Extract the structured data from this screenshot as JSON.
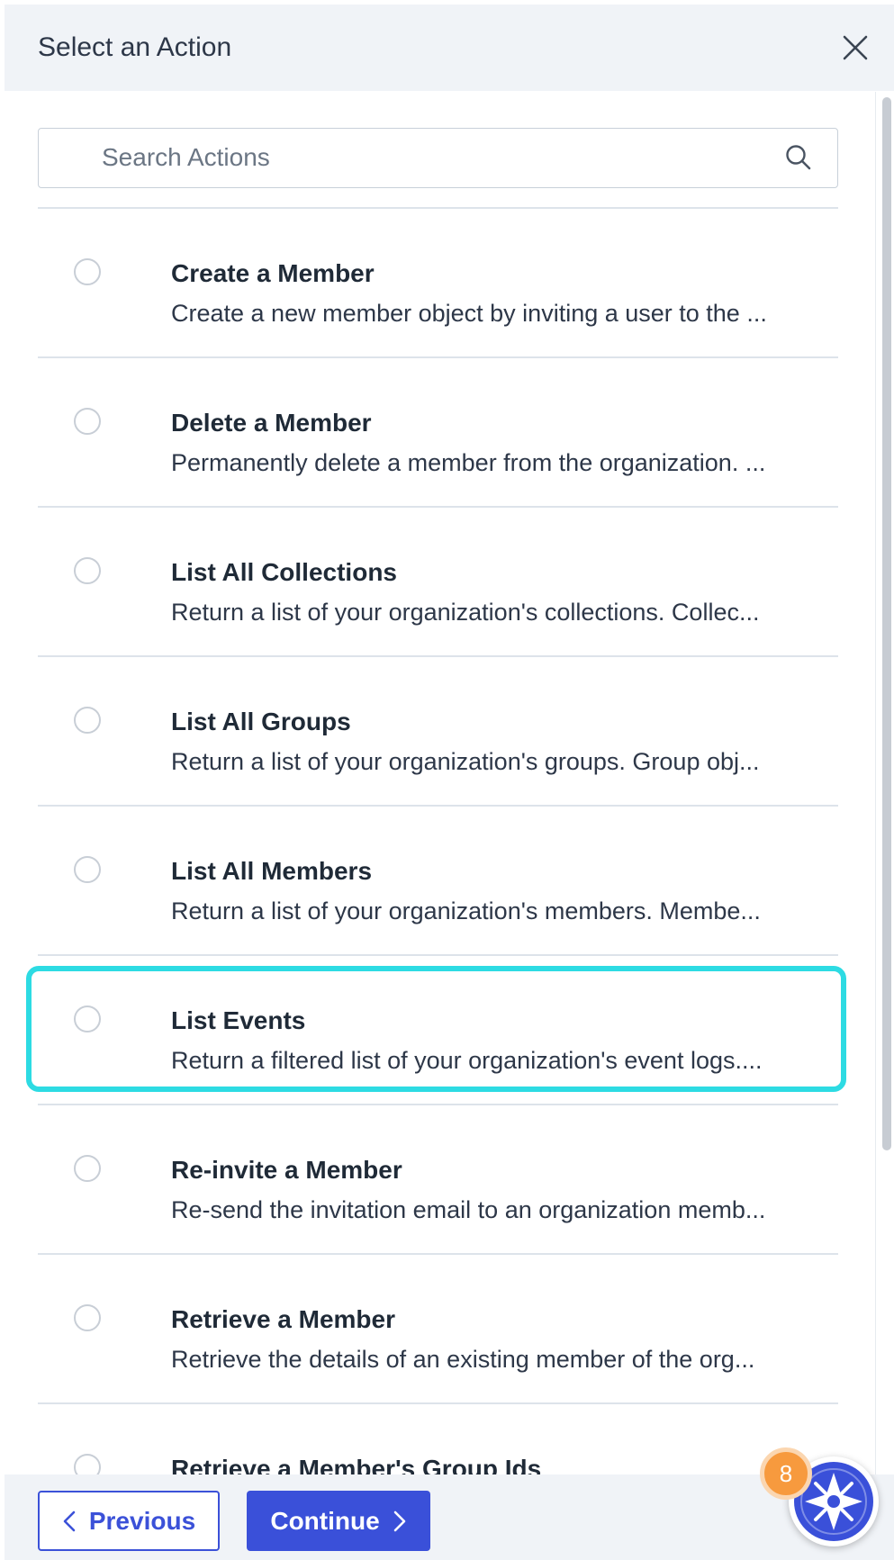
{
  "header": {
    "title": "Select an Action"
  },
  "search": {
    "placeholder": "Search Actions"
  },
  "actions": [
    {
      "title": "Create a Member",
      "description": "Create a new member object by inviting a user to the ..."
    },
    {
      "title": "Delete a Member",
      "description": "Permanently delete a member from the organization. ..."
    },
    {
      "title": "List All Collections",
      "description": "Return a list of your organization's collections. Collec..."
    },
    {
      "title": "List All Groups",
      "description": "Return a list of your organization's groups. Group obj..."
    },
    {
      "title": "List All Members",
      "description": "Return a list of your organization's members. Membe..."
    },
    {
      "title": "List Events",
      "description": "Return a filtered list of your organization's event logs...."
    },
    {
      "title": "Re-invite a Member",
      "description": "Re-send the invitation email to an organization memb..."
    },
    {
      "title": "Retrieve a Member",
      "description": "Retrieve the details of an existing member of the org..."
    },
    {
      "title": "Retrieve a Member's Group Ids",
      "description": ""
    }
  ],
  "footer": {
    "previous_label": "Previous",
    "continue_label": "Continue"
  },
  "assistant": {
    "badge_count": "8"
  },
  "colors": {
    "accent": "#3a50d9",
    "highlight": "#2ddbe3",
    "badge": "#f79a3e"
  }
}
